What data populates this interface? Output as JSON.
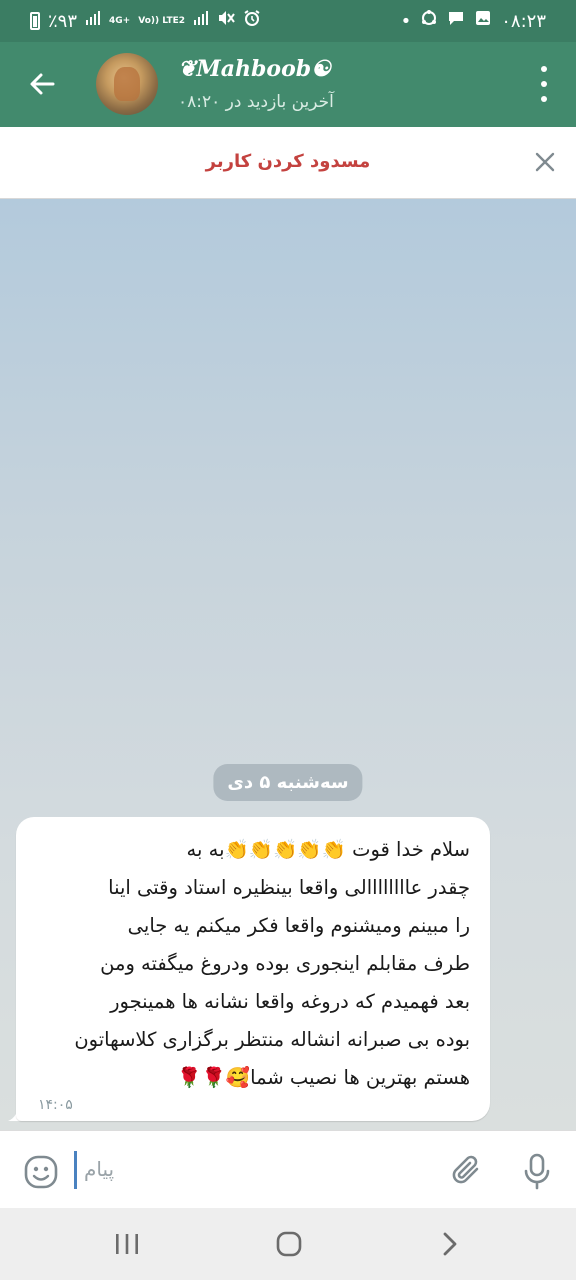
{
  "status_bar": {
    "battery": "٪۹۳",
    "network": "4G+",
    "volte": "Vo)) LTE2",
    "time": "۰۸:۲۳",
    "dot": "•"
  },
  "header": {
    "contact_name": "❦𝑴𝒂𝒉𝒃𝒐𝒐𝒃☯",
    "last_seen": "آخرین بازدید در ۰۸:۲۰"
  },
  "block_bar": {
    "label": "مسدود کردن کاربر"
  },
  "chat": {
    "date": "سه‌شنبه ۵ دی",
    "message": {
      "text": "سلام خدا قوت 👏👏👏👏👏به به\nچقدر عاااااااالی واقعا بینظیره استاد وقتی اینا\nرا مبینم ومیشنوم واقعا فکر میکنم یه جایی\nطرف مقابلم اینجوری بوده ودروغ میگفته ومن\nبعد فهمیدم که دروغه واقعا نشانه ها همینجور\nبوده بی صبرانه انشاله منتظر برگزاری کلاسهاتون\nهستم بهترین ها نصیب شما🥰🌹🌹",
      "time": "۱۴:۰۵"
    }
  },
  "input_bar": {
    "placeholder": "پیام"
  },
  "icons": {
    "back": "arrow-left-icon",
    "menu": "more-vert-icon",
    "close": "close-icon",
    "emoji": "emoji-icon",
    "attach": "paperclip-icon",
    "mic": "mic-icon"
  },
  "colors": {
    "header": "#428a6d",
    "status_bar": "#3b7d63",
    "block_label": "#c4423f",
    "date_chip": "#aeb9c0"
  }
}
